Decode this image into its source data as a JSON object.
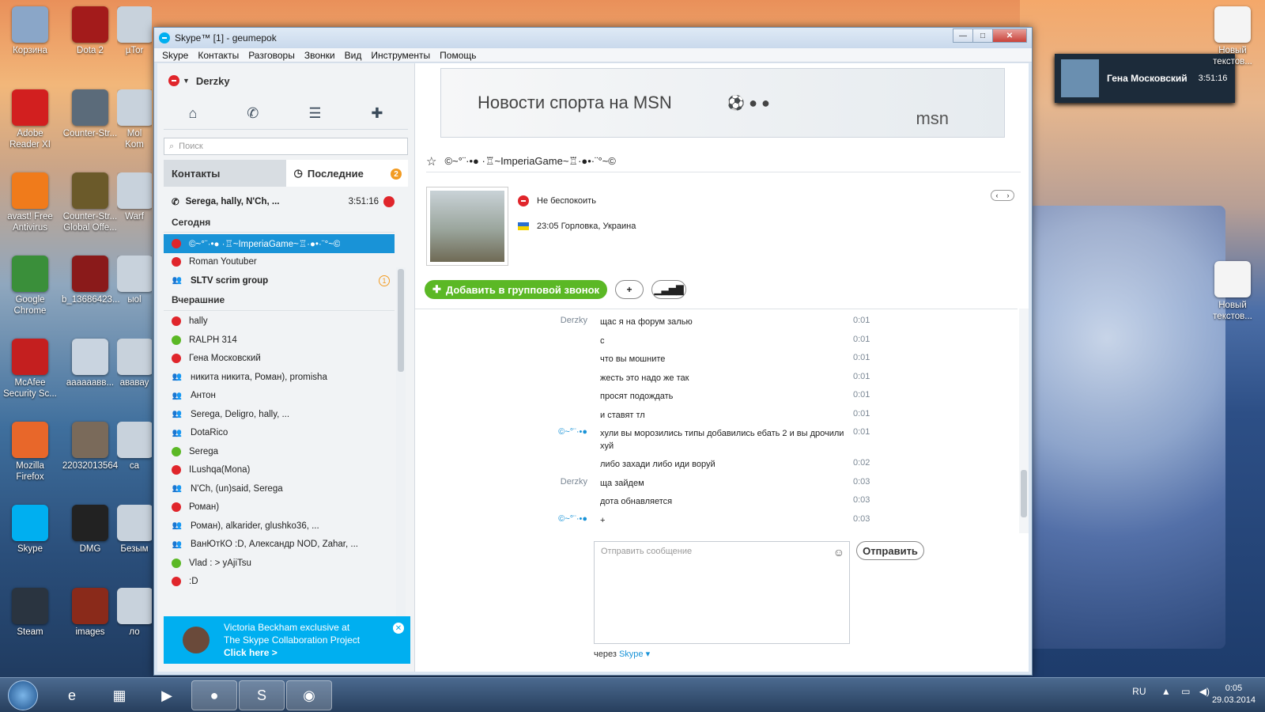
{
  "desktop": {
    "icons_left": [
      {
        "label": "Корзина",
        "color": "#8aa6c8"
      },
      {
        "label": "Adobe Reader XI",
        "color": "#d21f1f"
      },
      {
        "label": "avast! Free Antivirus",
        "color": "#f07b1b"
      },
      {
        "label": "Google Chrome",
        "color": "#3a8f3a"
      },
      {
        "label": "McAfee Security Sc...",
        "color": "#c41f1f"
      },
      {
        "label": "Mozilla Firefox",
        "color": "#e8672a"
      },
      {
        "label": "Skype",
        "color": "#00aff0"
      },
      {
        "label": "Steam",
        "color": "#2a3440"
      }
    ],
    "icons_col2": [
      {
        "label": "Dota 2",
        "color": "#a31b1b"
      },
      {
        "label": "Counter-Str...",
        "color": "#5b6b7a"
      },
      {
        "label": "Counter-Str... Global Offe...",
        "color": "#6b5a2a"
      },
      {
        "label": "b_13686423...",
        "color": "#8a1a1a"
      },
      {
        "label": "аааааавв...",
        "color": "#c9d4e0"
      },
      {
        "label": "22032013564",
        "color": "#7a6a5a"
      },
      {
        "label": "DMG",
        "color": "#222222"
      },
      {
        "label": "images",
        "color": "#8a2a1a"
      }
    ],
    "icons_col3": [
      "µTor",
      "Mol Kom",
      "Warf",
      "ыоl",
      "ававау",
      "ca",
      "Безым",
      "ло"
    ],
    "icons_right": [
      "Новый текстов...",
      "Новый текстов..."
    ]
  },
  "window": {
    "title": "Skype™ [1] - geumepok",
    "min": "—",
    "max": "□",
    "close": "✕"
  },
  "menu": [
    "Skype",
    "Контакты",
    "Разговоры",
    "Звонки",
    "Вид",
    "Инструменты",
    "Помощь"
  ],
  "profile": {
    "name": "Derzky"
  },
  "nav_icons": [
    "home-icon",
    "phone-icon",
    "group-icon",
    "add-contact-icon"
  ],
  "search": {
    "placeholder": "Поиск"
  },
  "tabs": {
    "contacts": "Контакты",
    "recent": "Последние",
    "recent_badge": "2"
  },
  "recent_call": {
    "name": "Serega, hally, N'Ch, ...",
    "time": "3:51:16"
  },
  "sections": {
    "today": "Сегодня",
    "yesterday": "Вчерашние"
  },
  "today_items": [
    {
      "name": "©~°¨·•● ·♖~ImperiaGame~♖·●•·¨°~©",
      "status": "busy",
      "selected": true
    },
    {
      "name": "Roman Youtuber",
      "status": "busy"
    },
    {
      "name": "SLTV scrim group",
      "status": "grp",
      "bold": true,
      "badge": "1"
    }
  ],
  "yesterday_items": [
    {
      "name": "hally",
      "status": "busy"
    },
    {
      "name": "RALPH 314",
      "status": "on"
    },
    {
      "name": "Гена Московский",
      "status": "busy"
    },
    {
      "name": "никита никита, Роман), promisha",
      "status": "grp"
    },
    {
      "name": "Антон",
      "status": "grp"
    },
    {
      "name": "Serega, Deligro, hally, ...",
      "status": "grp"
    },
    {
      "name": "DotaRico",
      "status": "grp"
    },
    {
      "name": "Serega",
      "status": "on"
    },
    {
      "name": "ILushqa(Mona)",
      "status": "busy"
    },
    {
      "name": "N'Ch, (un)said, Serega",
      "status": "grp"
    },
    {
      "name": "Роман)",
      "status": "busy"
    },
    {
      "name": "Роман), alkarider, glushko36, ...",
      "status": "grp"
    },
    {
      "name": "ВанЮтКО :D, Александр NOD, Zahar, ...",
      "status": "grp"
    },
    {
      "name": "Vlad : > yAjiTsu",
      "status": "on"
    },
    {
      "name": ":D",
      "status": "busy"
    }
  ],
  "ad_left": {
    "line1": "Victoria Beckham exclusive at",
    "line2": "The Skype Collaboration Project",
    "line3": "Click here >"
  },
  "ad_top": {
    "text": "Новости спорта на MSN",
    "logo": "msn"
  },
  "chat": {
    "title": "©~°¨·•● ·♖~ImperiaGame~♖·●•·¨°~©",
    "status": "Не беспокоить",
    "local": "23:05 Горловка, Украина",
    "add_group_call": "Добавить в групповой звонок",
    "add_btn": "+",
    "quality_btn": "signal-icon"
  },
  "messages": [
    {
      "who": "Derzky",
      "text": "щас я на форум залью",
      "time": "0:01"
    },
    {
      "who": "",
      "text": "с",
      "time": "0:01"
    },
    {
      "who": "",
      "text": "что вы мошните",
      "time": "0:01"
    },
    {
      "who": "",
      "text": "жесть это надо же так",
      "time": "0:01"
    },
    {
      "who": "",
      "text": "просят подождать",
      "time": "0:01"
    },
    {
      "who": "",
      "text": "и ставят тл",
      "time": "0:01"
    },
    {
      "who": "©~°¨·•●",
      "text": "хули вы морозились типы добавились ебать 2 и вы дрочили хуй",
      "time": "0:01"
    },
    {
      "who": "",
      "text": "либо захади либо иди воруй",
      "time": "0:02"
    },
    {
      "who": "Derzky",
      "text": "ща зайдем",
      "time": "0:03"
    },
    {
      "who": "",
      "text": "дота обнавляется",
      "time": "0:03"
    },
    {
      "who": "©~°¨·•●",
      "text": "+",
      "time": "0:03"
    }
  ],
  "compose": {
    "placeholder": "Отправить сообщение",
    "send": "Отправить",
    "via": "через",
    "via_link": "Skype ▾"
  },
  "notification": {
    "name": "Гена Московский",
    "time": "3:51:16"
  },
  "taskbar": {
    "lang": "RU",
    "time": "0:05",
    "date": "29.03.2014"
  }
}
